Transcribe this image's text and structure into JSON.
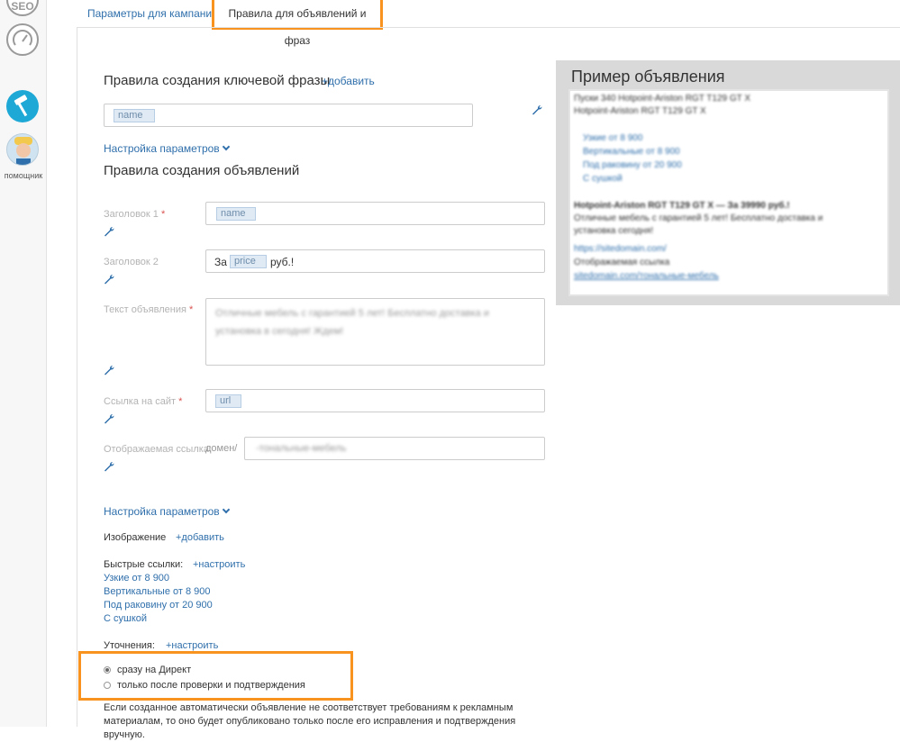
{
  "sidebar": {
    "seo_label": "SEO",
    "assistant_label": "помощник"
  },
  "tabs": [
    {
      "label": "Параметры для кампании"
    },
    {
      "label": "Правила для объявлений и фраз"
    }
  ],
  "keyphrase": {
    "title": "Правила создания ключевой фразы",
    "add": "+добавить",
    "token": "name",
    "params": "Настройка параметров"
  },
  "ads": {
    "title": "Правила создания объявлений",
    "headline1": {
      "label": "Заголовок 1",
      "token": "name"
    },
    "headline2": {
      "label": "Заголовок 2",
      "prefix": "За",
      "token": "price",
      "suffix": "руб.!"
    },
    "text": {
      "label": "Текст объявления",
      "value": "Отличные мебель с гарантией 5 лет! Бесплатно доставка и установка в сегодня! Ждем!"
    },
    "url": {
      "label": "Ссылка на сайт",
      "token": "url"
    },
    "display": {
      "label": "Отображаемая ссылка:",
      "domain": "домен/",
      "value": "-тональные-мебель"
    },
    "params": "Настройка параметров"
  },
  "image": {
    "label": "Изображение",
    "add": "+добавить"
  },
  "quicklinks": {
    "label": "Быстрые ссылки:",
    "configure": "+настроить",
    "items": [
      "Узкие от 8 900",
      "Вертикальные от 8 900",
      "Под раковину от 20 900",
      "С сушкой"
    ]
  },
  "refinements": {
    "label": "Уточнения:",
    "configure": "+настроить"
  },
  "publish": {
    "option1": "сразу на Директ",
    "option2": "только после проверки и подтверждения",
    "note": "Если созданное автоматически объявление не соответствует требованиям к рекламным материалам, то оно будет опубликовано только после его исправления и подтверждения вручную."
  },
  "example": {
    "title": "Пример объявления",
    "lines": [
      "Пуски 340 Hotpoint-Ariston RGT T129 GT X",
      "Hotpoint-Ariston RGT T129 GT X",
      "Узкие от 8 900",
      "Вертикальные от 8 900",
      "Под раковину от 20 900",
      "С сушкой",
      "Hotpoint-Ariston RGT T129 GT X — За 39990 руб.!",
      "Отличные мебель с гарантией 5 лет! Бесплатно доставка и",
      "установка сегодня!",
      "https://sitedomain.com/",
      "Отображаемая ссылка",
      "sitedomain.com/тональные-мебель"
    ]
  }
}
